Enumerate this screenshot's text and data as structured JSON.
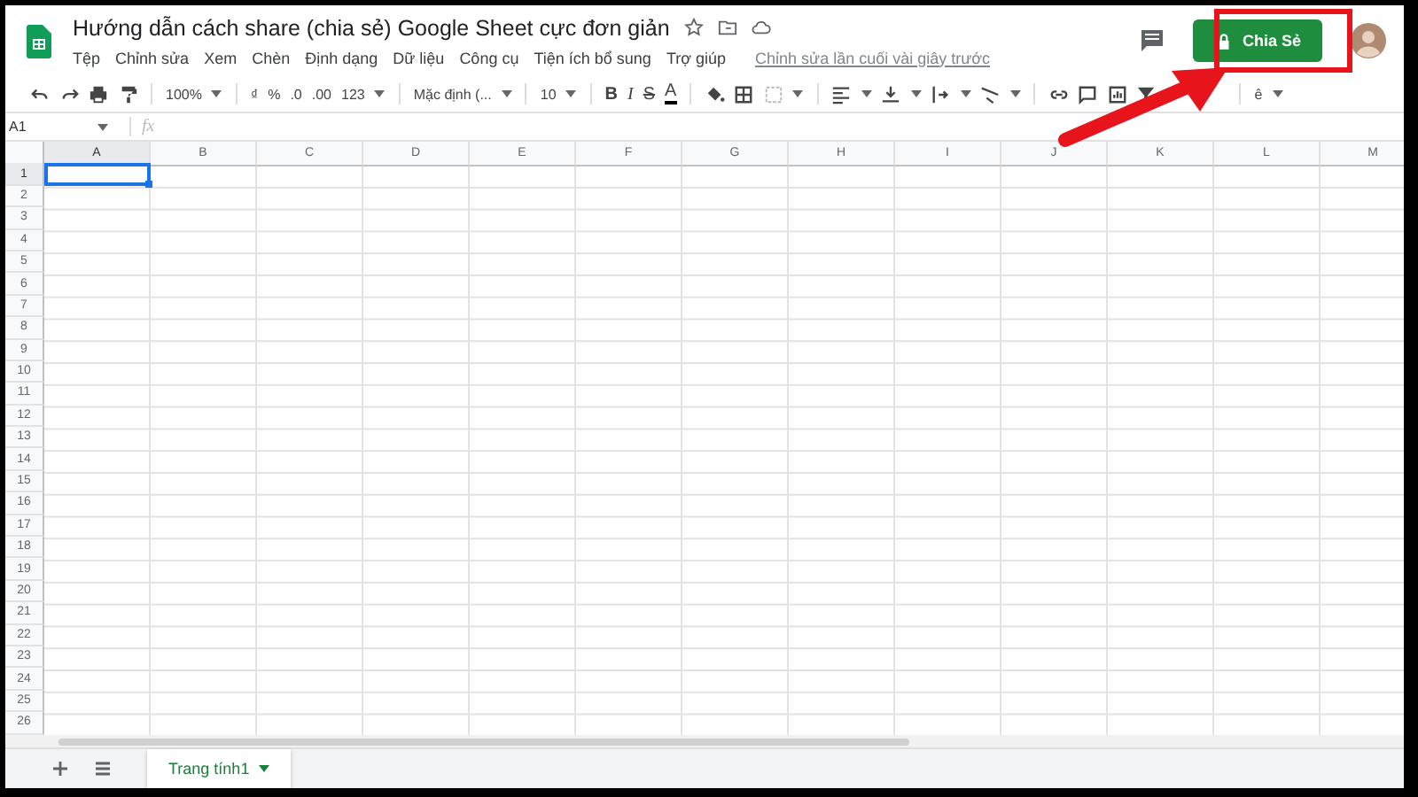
{
  "document": {
    "title": "Hướng dẫn cách share (chia sẻ) Google Sheet cực đơn giản",
    "last_edit": "Chỉnh sửa lần cuối vài giây trước"
  },
  "menu": [
    "Tệp",
    "Chỉnh sửa",
    "Xem",
    "Chèn",
    "Định dạng",
    "Dữ liệu",
    "Công cụ",
    "Tiện ích bổ sung",
    "Trợ giúp"
  ],
  "share_button": {
    "label": "Chia Sẻ"
  },
  "toolbar": {
    "zoom": "100%",
    "currency": "₫",
    "percent": "%",
    "decimal_less": ".0",
    "decimal_more": ".00",
    "number_format": "123",
    "font": "Mặc định (...",
    "font_size": "10",
    "bold": "B",
    "italic": "I",
    "strikethrough": "S",
    "text_color": "A",
    "input_tool": "ê"
  },
  "formula_bar": {
    "name_box": "A1",
    "fx": "fx"
  },
  "columns": [
    {
      "label": "A",
      "selected": true
    },
    {
      "label": "B",
      "selected": false
    },
    {
      "label": "C",
      "selected": false
    },
    {
      "label": "D",
      "selected": false
    },
    {
      "label": "E",
      "selected": false
    },
    {
      "label": "F",
      "selected": false
    },
    {
      "label": "G",
      "selected": false
    },
    {
      "label": "H",
      "selected": false
    },
    {
      "label": "I",
      "selected": false
    },
    {
      "label": "J",
      "selected": false
    },
    {
      "label": "K",
      "selected": false
    },
    {
      "label": "L",
      "selected": false
    },
    {
      "label": "M",
      "selected": false
    }
  ],
  "rows": [
    {
      "label": "1",
      "selected": true
    },
    {
      "label": "2",
      "selected": false
    },
    {
      "label": "3",
      "selected": false
    },
    {
      "label": "4",
      "selected": false
    },
    {
      "label": "5",
      "selected": false
    },
    {
      "label": "6",
      "selected": false
    },
    {
      "label": "7",
      "selected": false
    },
    {
      "label": "8",
      "selected": false
    },
    {
      "label": "9",
      "selected": false
    },
    {
      "label": "10",
      "selected": false
    },
    {
      "label": "11",
      "selected": false
    },
    {
      "label": "12",
      "selected": false
    },
    {
      "label": "13",
      "selected": false
    },
    {
      "label": "14",
      "selected": false
    },
    {
      "label": "15",
      "selected": false
    },
    {
      "label": "16",
      "selected": false
    },
    {
      "label": "17",
      "selected": false
    },
    {
      "label": "18",
      "selected": false
    },
    {
      "label": "19",
      "selected": false
    },
    {
      "label": "20",
      "selected": false
    },
    {
      "label": "21",
      "selected": false
    },
    {
      "label": "22",
      "selected": false
    },
    {
      "label": "23",
      "selected": false
    },
    {
      "label": "24",
      "selected": false
    },
    {
      "label": "25",
      "selected": false
    },
    {
      "label": "26",
      "selected": false
    }
  ],
  "sheet_tabs": [
    {
      "label": "Trang tính1",
      "selected": true
    }
  ]
}
